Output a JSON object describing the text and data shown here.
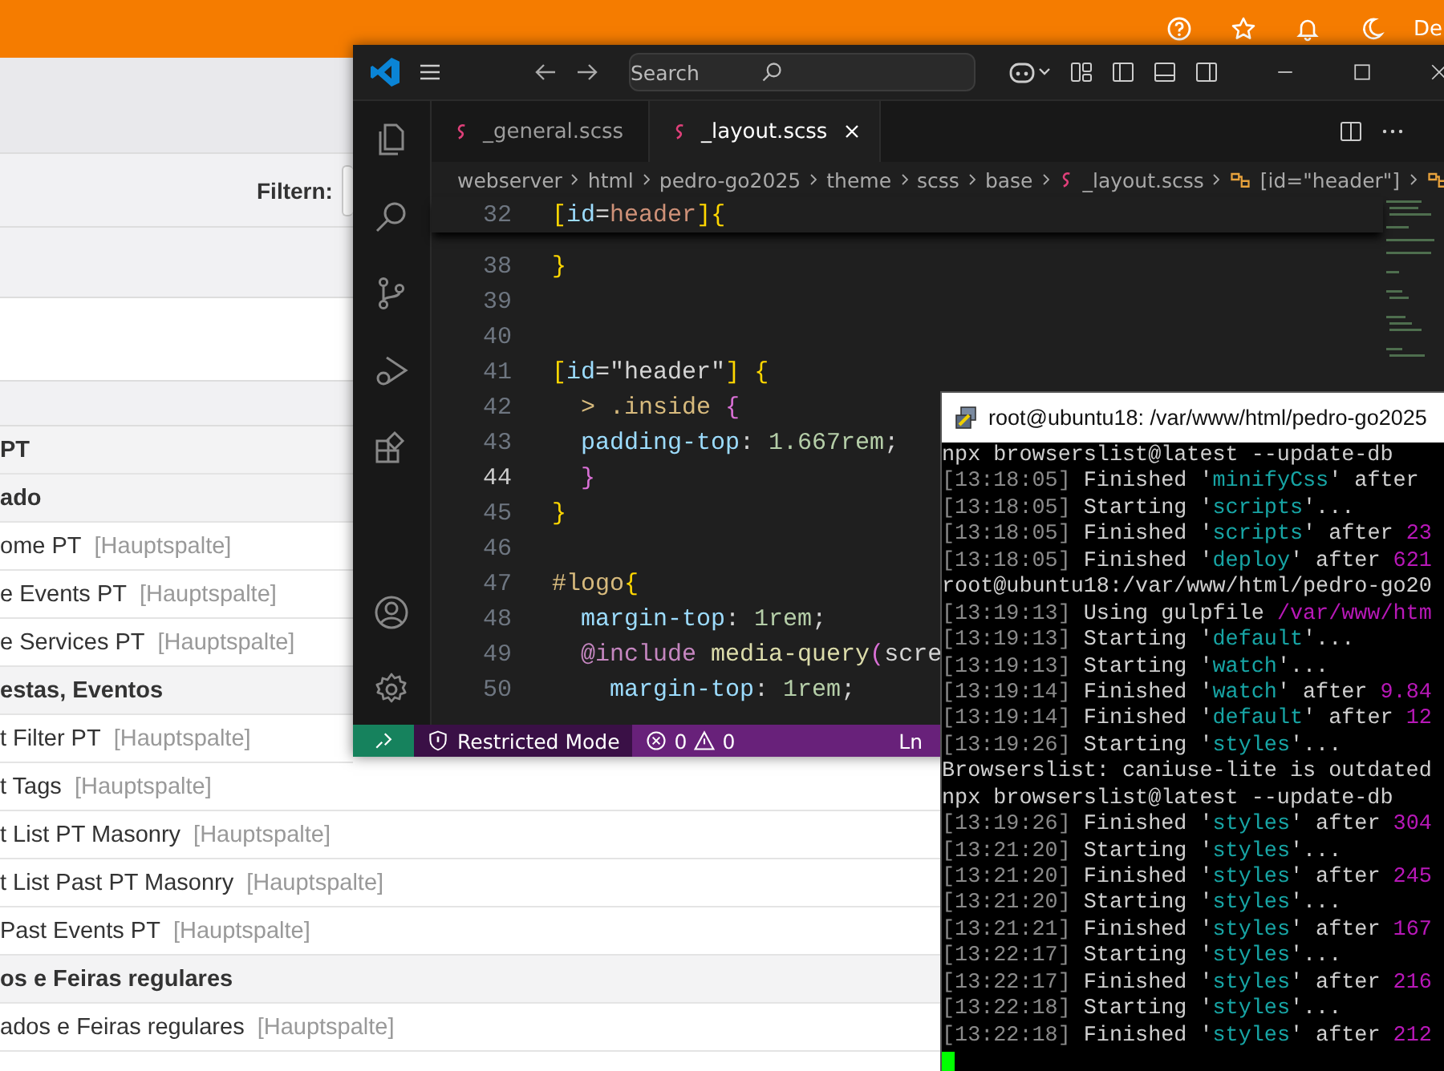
{
  "browser": {
    "user_text": "De",
    "filter_label": "Filtern:",
    "rows": [
      {
        "kind": "group",
        "label": "PT"
      },
      {
        "kind": "group",
        "label": "ado"
      },
      {
        "kind": "item",
        "label": "ome PT",
        "tag": "[Hauptspalte]"
      },
      {
        "kind": "item",
        "label": "e Events PT",
        "tag": "[Hauptspalte]"
      },
      {
        "kind": "item",
        "label": "e Services PT",
        "tag": "[Hauptspalte]"
      },
      {
        "kind": "group",
        "label": "estas, Eventos"
      },
      {
        "kind": "item",
        "label": "t Filter PT",
        "tag": "[Hauptspalte]"
      },
      {
        "kind": "item",
        "label": "t Tags",
        "tag": "[Hauptspalte]"
      },
      {
        "kind": "item",
        "label": "t List PT Masonry",
        "tag": "[Hauptspalte]"
      },
      {
        "kind": "item",
        "label": "t List Past PT Masonry",
        "tag": "[Hauptspalte]"
      },
      {
        "kind": "item",
        "label": "Past Events PT",
        "tag": "[Hauptspalte]"
      },
      {
        "kind": "group",
        "label": "os e Feiras regulares"
      },
      {
        "kind": "item",
        "label": "ados e Feiras regulares",
        "tag": "[Hauptspalte]"
      }
    ]
  },
  "editor": {
    "search": {
      "placeholder": "Search"
    },
    "tabs": [
      {
        "label": "_general.scss",
        "selected": false
      },
      {
        "label": "_layout.scss",
        "selected": true
      }
    ],
    "breadcrumb": [
      "webserver",
      "html",
      "pedro-go2025",
      "theme",
      "scss",
      "base",
      "_layout.scss",
      "[id=\"header\"]"
    ],
    "sticky": {
      "number": "32",
      "tokens": [
        {
          "kind": "b1",
          "text": "["
        },
        {
          "kind": "attr",
          "text": "id"
        },
        {
          "kind": "plain",
          "text": "="
        },
        {
          "kind": "str",
          "text": "header"
        },
        {
          "kind": "b1",
          "text": "]{"
        }
      ]
    },
    "lines": [
      {
        "number": "38",
        "current": false,
        "tokens": [
          {
            "kind": "b1",
            "text": "}"
          }
        ]
      },
      {
        "number": "39",
        "current": false
      },
      {
        "number": "40",
        "current": false
      },
      {
        "number": "41",
        "current": false,
        "tokens": [
          {
            "kind": "b1",
            "text": "["
          },
          {
            "kind": "attr",
            "text": "id"
          },
          {
            "kind": "plain",
            "text": "="
          },
          {
            "kind": "str2",
            "text": "\"header\""
          },
          {
            "kind": "b1",
            "text": "] {"
          }
        ]
      },
      {
        "number": "42",
        "current": false,
        "tokens": [
          {
            "kind": "sel",
            "text": "  > .inside "
          },
          {
            "kind": "b2",
            "text": "{"
          }
        ]
      },
      {
        "number": "43",
        "current": false,
        "tokens": [
          {
            "kind": "prop",
            "text": "  padding-top"
          },
          {
            "kind": "plain",
            "text": ": "
          },
          {
            "kind": "num",
            "text": "1.667rem"
          },
          {
            "kind": "plain",
            "text": ";"
          }
        ]
      },
      {
        "number": "44",
        "current": true,
        "tokens": [
          {
            "kind": "b2",
            "text": "  }"
          }
        ]
      },
      {
        "number": "45",
        "current": false,
        "tokens": [
          {
            "kind": "b1",
            "text": "}"
          }
        ]
      },
      {
        "number": "46",
        "current": false
      },
      {
        "number": "47",
        "current": false,
        "tokens": [
          {
            "kind": "sel",
            "text": "#logo"
          },
          {
            "kind": "b1",
            "text": "{"
          }
        ]
      },
      {
        "number": "48",
        "current": false,
        "tokens": [
          {
            "kind": "prop",
            "text": "  margin-top"
          },
          {
            "kind": "plain",
            "text": ": "
          },
          {
            "kind": "num",
            "text": "1rem"
          },
          {
            "kind": "plain",
            "text": ";"
          }
        ]
      },
      {
        "number": "49",
        "current": false,
        "tokens": [
          {
            "kind": "at",
            "text": "  @include"
          },
          {
            "kind": "fn",
            "text": " media-query"
          },
          {
            "kind": "b2",
            "text": "("
          },
          {
            "kind": "plain",
            "text": "scre"
          }
        ]
      },
      {
        "number": "50",
        "current": false,
        "tokens": [
          {
            "kind": "prop",
            "text": "    margin-top"
          },
          {
            "kind": "plain",
            "text": ": "
          },
          {
            "kind": "num",
            "text": "1rem"
          },
          {
            "kind": "plain",
            "text": ";"
          }
        ]
      }
    ],
    "status": {
      "mode": "Restricted Mode",
      "errors": "0",
      "warnings": "0",
      "position": "Ln"
    }
  },
  "terminal": {
    "title": "root@ubuntu18: /var/www/html/pedro-go2025",
    "lines": [
      [
        {
          "kind": "plain",
          "text": "npx browserslist@latest --update-db"
        }
      ],
      [
        {
          "kind": "time",
          "text": "[13:18:05]"
        },
        {
          "kind": "plain",
          "text": " Finished '"
        },
        {
          "kind": "task",
          "text": "minifyCss"
        },
        {
          "kind": "plain",
          "text": "' after"
        }
      ],
      [
        {
          "kind": "time",
          "text": "[13:18:05]"
        },
        {
          "kind": "plain",
          "text": " Starting '"
        },
        {
          "kind": "task",
          "text": "scripts"
        },
        {
          "kind": "plain",
          "text": "'..."
        }
      ],
      [
        {
          "kind": "time",
          "text": "[13:18:05]"
        },
        {
          "kind": "plain",
          "text": " Finished '"
        },
        {
          "kind": "task",
          "text": "scripts"
        },
        {
          "kind": "plain",
          "text": "' after "
        },
        {
          "kind": "num",
          "text": "23"
        }
      ],
      [
        {
          "kind": "time",
          "text": "[13:18:05]"
        },
        {
          "kind": "plain",
          "text": " Finished '"
        },
        {
          "kind": "task",
          "text": "deploy"
        },
        {
          "kind": "plain",
          "text": "' after "
        },
        {
          "kind": "num",
          "text": "621"
        }
      ],
      [
        {
          "kind": "plain",
          "text": "root@ubuntu18:/var/www/html/pedro-go20"
        }
      ],
      [
        {
          "kind": "time",
          "text": "[13:19:13]"
        },
        {
          "kind": "plain",
          "text": " Using gulpfile "
        },
        {
          "kind": "num",
          "text": "/var/www/htm"
        }
      ],
      [
        {
          "kind": "time",
          "text": "[13:19:13]"
        },
        {
          "kind": "plain",
          "text": " Starting '"
        },
        {
          "kind": "task",
          "text": "default"
        },
        {
          "kind": "plain",
          "text": "'..."
        }
      ],
      [
        {
          "kind": "time",
          "text": "[13:19:13]"
        },
        {
          "kind": "plain",
          "text": " Starting '"
        },
        {
          "kind": "task",
          "text": "watch"
        },
        {
          "kind": "plain",
          "text": "'..."
        }
      ],
      [
        {
          "kind": "time",
          "text": "[13:19:14]"
        },
        {
          "kind": "plain",
          "text": " Finished '"
        },
        {
          "kind": "task",
          "text": "watch"
        },
        {
          "kind": "plain",
          "text": "' after "
        },
        {
          "kind": "num",
          "text": "9.84"
        }
      ],
      [
        {
          "kind": "time",
          "text": "[13:19:14]"
        },
        {
          "kind": "plain",
          "text": " Finished '"
        },
        {
          "kind": "task",
          "text": "default"
        },
        {
          "kind": "plain",
          "text": "' after "
        },
        {
          "kind": "num",
          "text": "12"
        }
      ],
      [
        {
          "kind": "time",
          "text": "[13:19:26]"
        },
        {
          "kind": "plain",
          "text": " Starting '"
        },
        {
          "kind": "task",
          "text": "styles"
        },
        {
          "kind": "plain",
          "text": "'..."
        }
      ],
      [
        {
          "kind": "plain",
          "text": "Browserslist: caniuse-lite is outdated"
        }
      ],
      [
        {
          "kind": "plain",
          "text": "npx browserslist@latest --update-db"
        }
      ],
      [
        {
          "kind": "time",
          "text": "[13:19:26]"
        },
        {
          "kind": "plain",
          "text": " Finished '"
        },
        {
          "kind": "task",
          "text": "styles"
        },
        {
          "kind": "plain",
          "text": "' after "
        },
        {
          "kind": "num",
          "text": "304"
        }
      ],
      [
        {
          "kind": "time",
          "text": "[13:21:20]"
        },
        {
          "kind": "plain",
          "text": " Starting '"
        },
        {
          "kind": "task",
          "text": "styles"
        },
        {
          "kind": "plain",
          "text": "'..."
        }
      ],
      [
        {
          "kind": "time",
          "text": "[13:21:20]"
        },
        {
          "kind": "plain",
          "text": " Finished '"
        },
        {
          "kind": "task",
          "text": "styles"
        },
        {
          "kind": "plain",
          "text": "' after "
        },
        {
          "kind": "num",
          "text": "245"
        }
      ],
      [
        {
          "kind": "time",
          "text": "[13:21:20]"
        },
        {
          "kind": "plain",
          "text": " Starting '"
        },
        {
          "kind": "task",
          "text": "styles"
        },
        {
          "kind": "plain",
          "text": "'..."
        }
      ],
      [
        {
          "kind": "time",
          "text": "[13:21:21]"
        },
        {
          "kind": "plain",
          "text": " Finished '"
        },
        {
          "kind": "task",
          "text": "styles"
        },
        {
          "kind": "plain",
          "text": "' after "
        },
        {
          "kind": "num",
          "text": "167"
        }
      ],
      [
        {
          "kind": "time",
          "text": "[13:22:17]"
        },
        {
          "kind": "plain",
          "text": " Starting '"
        },
        {
          "kind": "task",
          "text": "styles"
        },
        {
          "kind": "plain",
          "text": "'..."
        }
      ],
      [
        {
          "kind": "time",
          "text": "[13:22:17]"
        },
        {
          "kind": "plain",
          "text": " Finished '"
        },
        {
          "kind": "task",
          "text": "styles"
        },
        {
          "kind": "plain",
          "text": "' after "
        },
        {
          "kind": "num",
          "text": "216"
        }
      ],
      [
        {
          "kind": "time",
          "text": "[13:22:18]"
        },
        {
          "kind": "plain",
          "text": " Starting '"
        },
        {
          "kind": "task",
          "text": "styles"
        },
        {
          "kind": "plain",
          "text": "'..."
        }
      ],
      [
        {
          "kind": "time",
          "text": "[13:22:18]"
        },
        {
          "kind": "plain",
          "text": " Finished '"
        },
        {
          "kind": "task",
          "text": "styles"
        },
        {
          "kind": "plain",
          "text": "' after "
        },
        {
          "kind": "num",
          "text": "212"
        }
      ]
    ]
  }
}
